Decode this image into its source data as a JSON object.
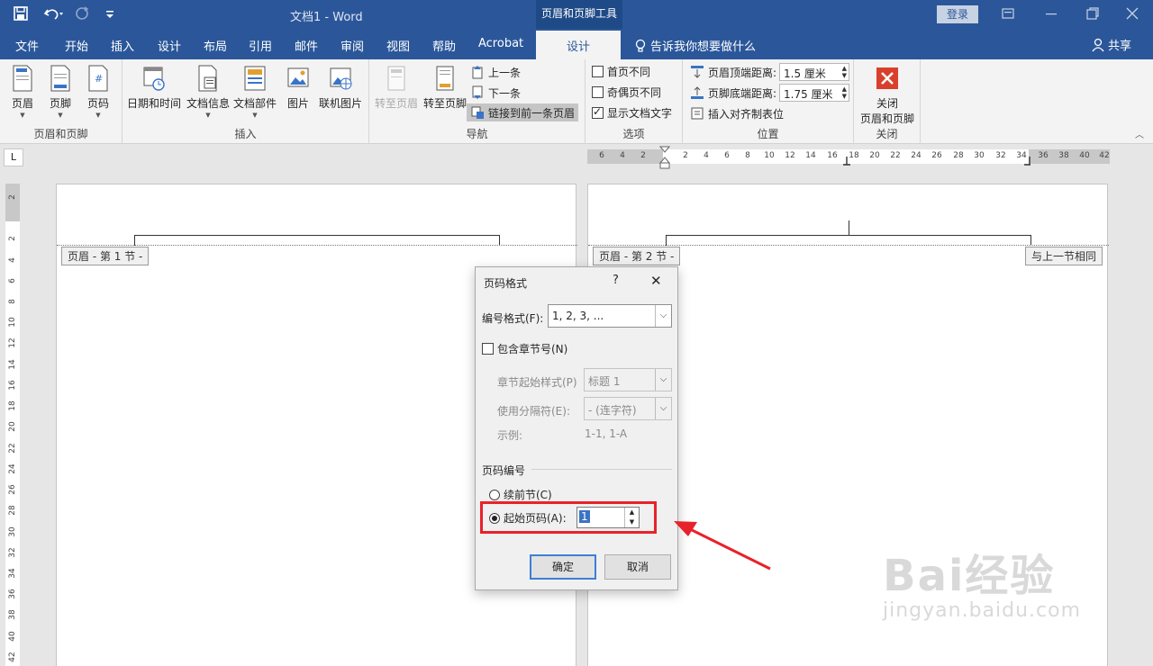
{
  "titlebar": {
    "doc_title": "文档1  -  Word",
    "context_tool": "页眉和页脚工具",
    "login": "登录"
  },
  "tabs": [
    "文件",
    "开始",
    "插入",
    "设计",
    "布局",
    "引用",
    "邮件",
    "审阅",
    "视图",
    "帮助",
    "Acrobat"
  ],
  "active_tab": "设计",
  "tell_me": "告诉我你想要做什么",
  "share": "共享",
  "ribbon": {
    "group_header_footer": {
      "label": "页眉和页脚",
      "header": "页眉",
      "footer": "页脚",
      "page_number": "页码"
    },
    "group_insert": {
      "label": "插入",
      "date_time": "日期和时间",
      "doc_info": "文档信息",
      "doc_parts": "文档部件",
      "picture": "图片",
      "online_picture": "联机图片"
    },
    "group_navigation": {
      "label": "导航",
      "goto_header": "转至页眉",
      "goto_footer": "转至页脚",
      "previous": "上一条",
      "next": "下一条",
      "link_previous": "链接到前一条页眉"
    },
    "group_options": {
      "label": "选项",
      "different_first": "首页不同",
      "different_odd_even": "奇偶页不同",
      "show_doc_text": "显示文档文字"
    },
    "group_position": {
      "label": "位置",
      "header_top": "页眉顶端距离:",
      "header_top_value": "1.5 厘米",
      "footer_bottom": "页脚底端距离:",
      "footer_bottom_value": "1.75 厘米",
      "insert_align_tab": "插入对齐制表位"
    },
    "group_close": {
      "label": "关闭",
      "close_line1": "关闭",
      "close_line2": "页眉和页脚"
    }
  },
  "ruler": {
    "corner": "L",
    "h_ticks": [
      "6",
      "4",
      "2",
      "2",
      "4",
      "6",
      "8",
      "10",
      "12",
      "14",
      "16",
      "18",
      "20",
      "22",
      "24",
      "26",
      "28",
      "30",
      "32",
      "34",
      "36",
      "38",
      "40",
      "42"
    ],
    "v_ticks": [
      "2",
      "2",
      "4",
      "6",
      "8",
      "10",
      "12",
      "14",
      "16",
      "18",
      "20",
      "22",
      "24",
      "26",
      "28",
      "30",
      "32",
      "34",
      "36",
      "38",
      "40",
      "42"
    ]
  },
  "pages": {
    "left_tag": "页眉 - 第 1 节 -",
    "right_tag": "页眉 - 第 2 节 -",
    "same_as_previous": "与上一节相同"
  },
  "dialog": {
    "title": "页码格式",
    "help": "?",
    "close": "✕",
    "number_format_label": "编号格式(F):",
    "number_format_value": "1, 2, 3, ...",
    "include_chapter": "包含章节号(N)",
    "chapter_style_label": "章节起始样式(P)",
    "chapter_style_value": "标题 1",
    "separator_label": "使用分隔符(E):",
    "separator_value": "-  (连字符)",
    "example_label": "示例:",
    "example_value": "1-1, 1-A",
    "numbering_section": "页码编号",
    "continue_prev": "续前节(C)",
    "start_at": "起始页码(A):",
    "start_at_value": "1",
    "ok": "确定",
    "cancel": "取消"
  },
  "watermark": {
    "line1": "Bai经验",
    "line2": "jingyan.baidu.com"
  },
  "colors": {
    "brand": "#2b579a",
    "highlight": "#e8222a",
    "close_red": "#d9402c"
  }
}
